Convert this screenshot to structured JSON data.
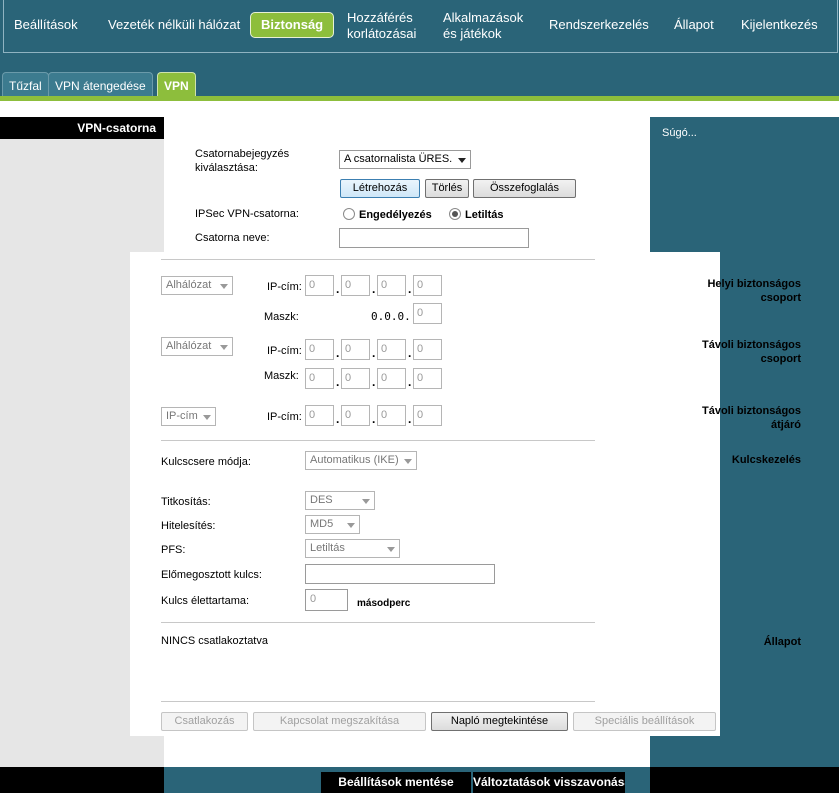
{
  "nav": {
    "items": [
      {
        "label": "Beállítások"
      },
      {
        "label": "Vezeték nélküli hálózat"
      },
      {
        "label": "Biztonság"
      },
      {
        "label": "Hozzáférés korlátozásai"
      },
      {
        "label": "Alkalmazások és játékok"
      },
      {
        "label": "Rendszerkezelés"
      },
      {
        "label": "Állapot"
      },
      {
        "label": "Kijelentkezés"
      }
    ],
    "active": "Biztonság",
    "hozzaferes_line1": "Hozzáférés",
    "hozzaferes_line2": "korlátozásai",
    "alkalmazasok_line1": "Alkalmazások",
    "alkalmazasok_line2": "és játékok"
  },
  "subtabs": [
    {
      "label": "Tűzfal"
    },
    {
      "label": "VPN átengedése"
    },
    {
      "label": "VPN"
    }
  ],
  "left": {
    "section_title": "VPN-csatorna",
    "local_group_1": "Helyi biztonságos",
    "local_group_2": "csoport",
    "remote_group_1": "Távoli biztonságos",
    "remote_group_2": "csoport",
    "remote_gw_1": "Távoli biztonságos",
    "remote_gw_2": "átjáró",
    "key_mgmt": "Kulcskezelés",
    "status": "Állapot"
  },
  "help": {
    "label": "Súgó..."
  },
  "tunnel": {
    "select_label_1": "Csatornabejegyzés",
    "select_label_2": "kiválasztása:",
    "select_value": "A csatornalista ÜRES.",
    "create": "Létrehozás",
    "delete": "Törlés",
    "summary": "Összefoglalás",
    "ipsec_label": "IPSec VPN-csatorna:",
    "enable": "Engedélyezés",
    "disable": "Letiltás",
    "name_label": "Csatorna neve:"
  },
  "local": {
    "type": "Alhálózat",
    "ip_label": "IP-cím:",
    "ip": [
      "0",
      "0",
      "0",
      "0"
    ],
    "mask_label": "Maszk:",
    "mask_text": "0.0.0.",
    "mask_last": "0"
  },
  "remote": {
    "type": "Alhálózat",
    "ip_label": "IP-cím:",
    "ip": [
      "0",
      "0",
      "0",
      "0"
    ],
    "mask_label": "Maszk:",
    "mask": [
      "0",
      "0",
      "0",
      "0"
    ]
  },
  "gateway": {
    "type": "IP-cím",
    "ip_label": "IP-cím:",
    "ip": [
      "0",
      "0",
      "0",
      "0"
    ]
  },
  "keys": {
    "exchange_label": "Kulcscsere módja:",
    "exchange_value": "Automatikus (IKE)",
    "enc_label": "Titkosítás:",
    "enc_value": "DES",
    "auth_label": "Hitelesítés:",
    "auth_value": "MD5",
    "pfs_label": "PFS:",
    "pfs_value": "Letiltás",
    "psk_label": "Előmegosztott kulcs:",
    "lifetime_label": "Kulcs élettartama:",
    "lifetime_value": "0",
    "lifetime_unit": "másodperc"
  },
  "status": {
    "text": "NINCS csatlakoztatva"
  },
  "actions": {
    "connect": "Csatlakozás",
    "disconnect": "Kapcsolat megszakítása",
    "view_log": "Napló megtekintése",
    "advanced": "Speciális beállítások"
  },
  "footer": {
    "save": "Beállítások mentése",
    "cancel": "Változtatások visszavonása"
  }
}
